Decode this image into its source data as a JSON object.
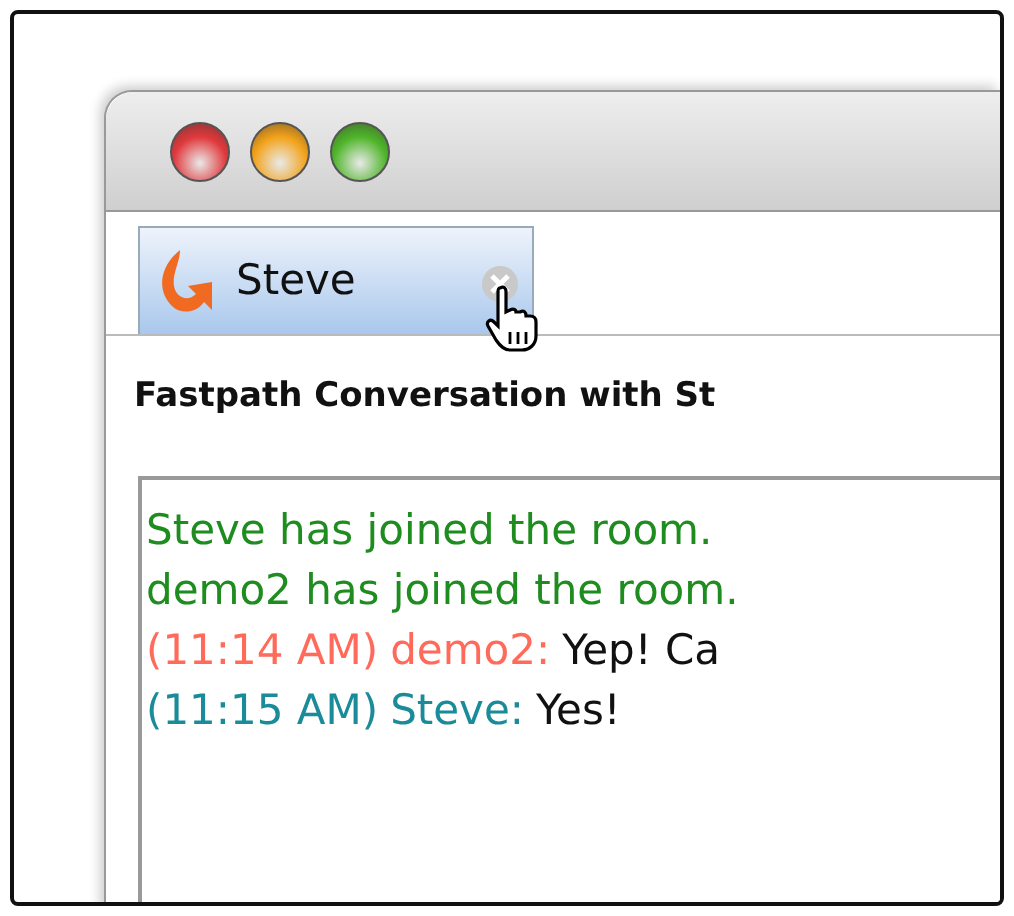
{
  "tabs": [
    {
      "label": "Steve",
      "selected": true
    }
  ],
  "heading": "Fastpath Conversation with St",
  "transcript": [
    {
      "kind": "event",
      "text": "Steve has joined the room."
    },
    {
      "kind": "event",
      "text": "demo2 has joined the room."
    },
    {
      "kind": "message",
      "time": "(11:14 AM)",
      "sender": "demo2:",
      "color": "#ff6a5a",
      "body": "Yep! Ca"
    },
    {
      "kind": "message",
      "time": "(11:15 AM)",
      "sender": "Steve:",
      "color": "#1a8c99",
      "body": "Yes!"
    }
  ]
}
